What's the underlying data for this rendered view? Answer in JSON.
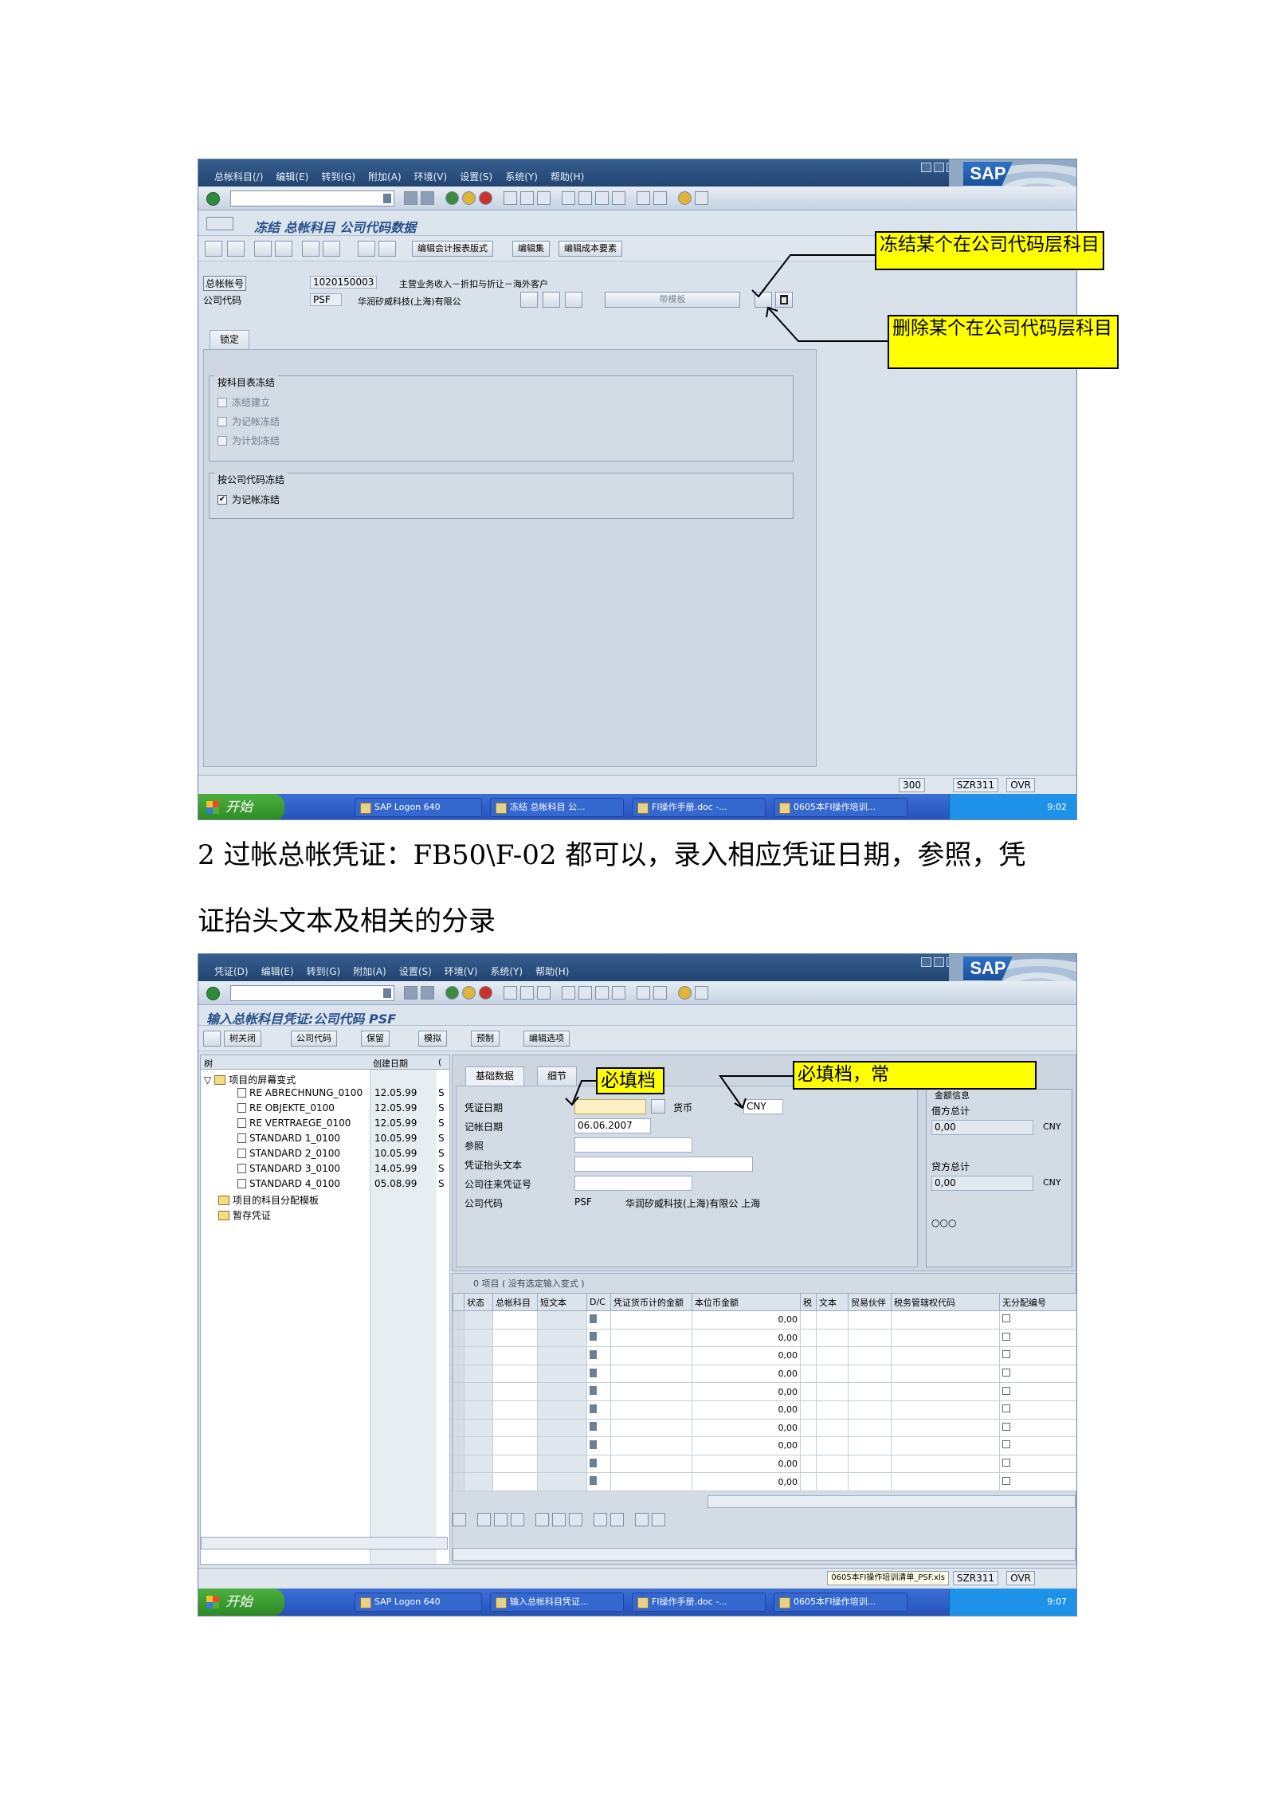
{
  "paragraph": {
    "line1": "2 过帐总帐凭证：FB50\\F-02 都可以，录入相应凭证日期，参照，凭",
    "line2": "证抬头文本及相关的分录"
  },
  "screen1": {
    "menu": [
      "总帐科目(/)",
      "编辑(E)",
      "转到(G)",
      "附加(A)",
      "环境(V)",
      "设置(S)",
      "系统(Y)",
      "帮助(H)"
    ],
    "logo": "SAP",
    "title": "冻结 总帐科目 公司代码数据",
    "app_buttons": [
      "编辑会计报表版式",
      "编辑集",
      "编辑成本要素"
    ],
    "gl_label": "总帐帐号",
    "gl_value": "1020150003",
    "gl_desc": "主营业务收入－折扣与折让－海外客户",
    "cc_label": "公司代码",
    "cc_value": "PSF",
    "cc_desc": "华润矽威科技(上海)有限公",
    "template_button": "带模板",
    "tab": "锁定",
    "group1_title": "按科目表冻结",
    "group1_items": [
      "冻结建立",
      "为记帐冻结",
      "为计划冻结"
    ],
    "group2_title": "按公司代码冻结",
    "group2_item": "为记帐冻结",
    "status": {
      "client": "300",
      "server": "SZR311",
      "mode": "OVR"
    },
    "taskbar": {
      "start": "开始",
      "apps": [
        "SAP Logon 640",
        "冻结 总帐科目 公...",
        "FI操作手册.doc -...",
        "0605本FI操作培训..."
      ],
      "time": "9:02"
    },
    "callout_freeze": "冻结某个在公司代码层科目",
    "callout_delete": "删除某个在公司代码层科目"
  },
  "screen2": {
    "menu": [
      "凭证(D)",
      "编辑(E)",
      "转到(G)",
      "附加(A)",
      "设置(S)",
      "环境(V)",
      "系统(Y)",
      "帮助(H)"
    ],
    "logo": "SAP",
    "title": "输入总帐科目凭证:公司代码 PSF",
    "app_buttons": [
      "树关闭",
      "公司代码",
      "保留",
      "模拟",
      "预制",
      "编辑选项"
    ],
    "tree_headers": [
      "树",
      "创建日期",
      "(",
      "s"
    ],
    "tree_root": "项目的屏幕变式",
    "tree_items": [
      {
        "name": "RE ABRECHNUNG_0100",
        "date": "12.05.99",
        "s": "S"
      },
      {
        "name": "RE OBJEKTE_0100",
        "date": "12.05.99",
        "s": "S"
      },
      {
        "name": "RE VERTRAEGE_0100",
        "date": "12.05.99",
        "s": "S"
      },
      {
        "name": "STANDARD 1_0100",
        "date": "10.05.99",
        "s": "S"
      },
      {
        "name": "STANDARD 2_0100",
        "date": "10.05.99",
        "s": "S"
      },
      {
        "name": "STANDARD 3_0100",
        "date": "14.05.99",
        "s": "S"
      },
      {
        "name": "STANDARD 4_0100",
        "date": "05.08.99",
        "s": "S"
      }
    ],
    "tree_folders": [
      "项目的科目分配模板",
      "暂存凭证"
    ],
    "tabs": [
      "基础数据",
      "细节"
    ],
    "fields": {
      "doc_date_label": "凭证日期",
      "currency_label": "货币",
      "currency_value": "CNY",
      "post_date_label": "记帐日期",
      "post_date_value": "06.06.2007",
      "ref_label": "参照",
      "header_text_label": "凭证抬头文本",
      "intercompany_label": "公司往来凭证号",
      "cc_label": "公司代码",
      "cc_value": "PSF",
      "cc_desc": "华润矽威科技(上海)有限公 上海"
    },
    "amount_info": {
      "title": "金额信息",
      "debit_label": "借方总计",
      "debit_value": "0,00",
      "debit_cur": "CNY",
      "credit_label": "贷方总计",
      "credit_value": "0,00",
      "credit_cur": "CNY",
      "lights": "○○○"
    },
    "items_caption": "0 项目 ( 没有选定输入变式 )",
    "grid_headers": [
      "状态",
      "总帐科目",
      "短文本",
      "D/C",
      "凭证货币计的金额",
      "本位币金额",
      "税",
      "文本",
      "贸易伙伴",
      "税务管辖权代码",
      "无分配编号"
    ],
    "grid_amounts": [
      "0,00",
      "0,00",
      "0,00",
      "0,00",
      "0,00",
      "0,00",
      "0,00",
      "0,00",
      "0,00",
      "0,00"
    ],
    "status": {
      "server": "SZR311",
      "mode": "OVR"
    },
    "tooltip_file": "0605本FI操作培训清单_PSF.xls",
    "taskbar": {
      "start": "开始",
      "apps": [
        "SAP Logon 640",
        "输入总帐科目凭证...",
        "FI操作手册.doc -...",
        "0605本FI操作培训..."
      ],
      "time": "9:07"
    },
    "callout_required1": "必填档",
    "callout_required2": "必填档，常"
  },
  "colors": {
    "callout": "#ffff00",
    "sap_blue": "#224470",
    "title_text": "#27508a",
    "taskbar": "#2452b9"
  }
}
